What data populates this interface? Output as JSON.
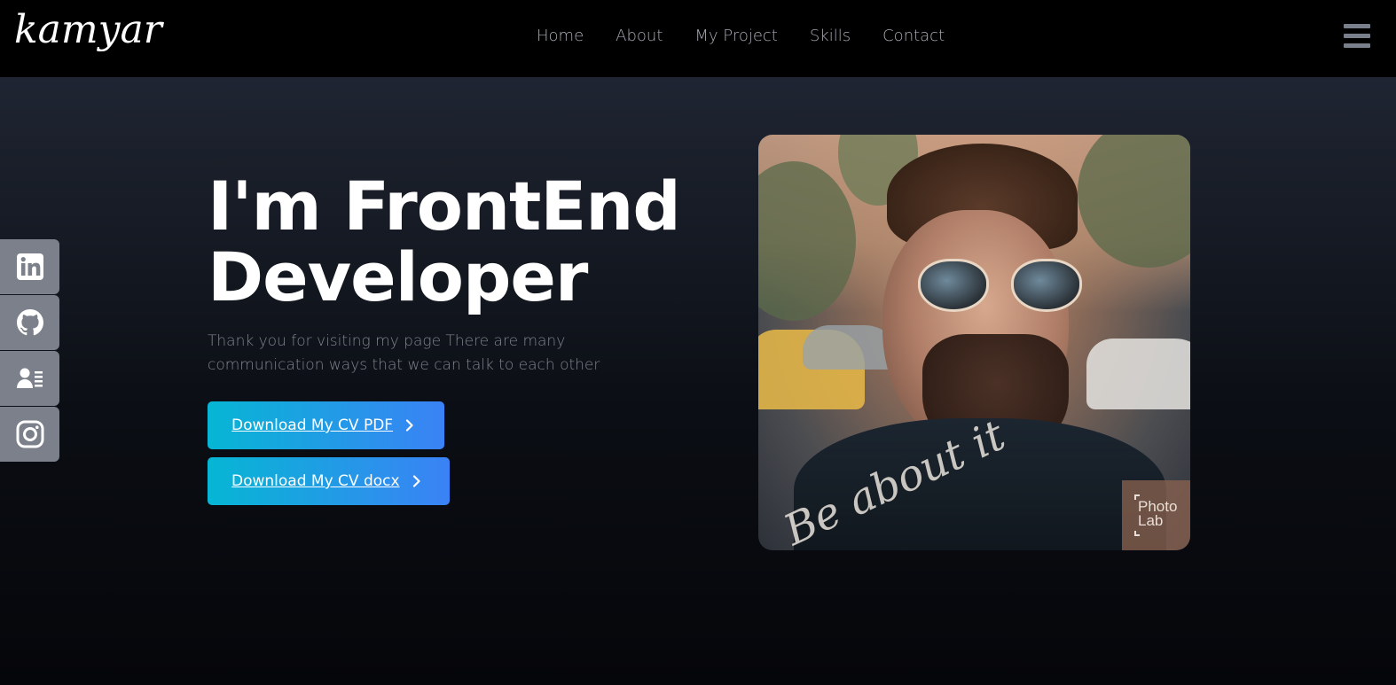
{
  "header": {
    "logo": "kamyar",
    "nav": [
      "Home",
      "About",
      "My Project",
      "Skills",
      "Contact"
    ],
    "menu_icon": "hamburger-icon"
  },
  "social": [
    {
      "icon": "linkedin-icon"
    },
    {
      "icon": "github-icon"
    },
    {
      "icon": "contact-card-icon"
    },
    {
      "icon": "instagram-icon"
    }
  ],
  "hero": {
    "title_line1": "I'm FrontEnd",
    "title_line2": "Developer",
    "subtitle": "Thank you for visiting my page There are many communication ways that we can talk to each other",
    "btn_pdf": "Download My CV PDF",
    "btn_docx": "Download My CV docx"
  },
  "portrait": {
    "signature": "Be about it",
    "badge_line1": "Photo",
    "badge_line2": "Lab"
  },
  "colors": {
    "button_start": "#06b6d4",
    "button_end": "#3b82f6",
    "header_bg": "#000000",
    "social_bg": "#7b808a"
  }
}
